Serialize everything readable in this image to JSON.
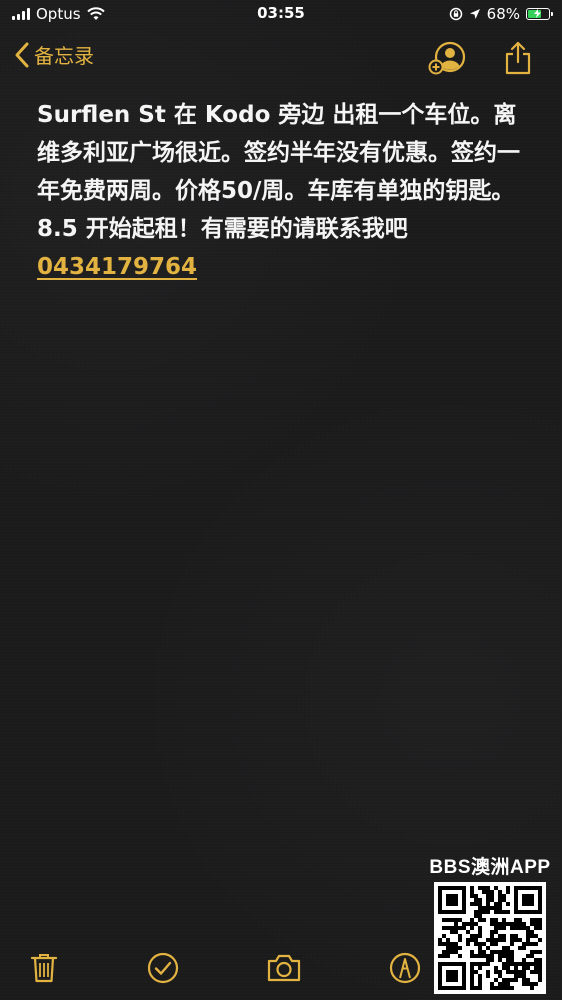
{
  "status_bar": {
    "carrier": "Optus",
    "time": "03:55",
    "battery_percent": "68%",
    "battery_level": 0.68,
    "icons": [
      "signal-icon",
      "wifi-icon",
      "screen-lock-icon",
      "location-icon",
      "battery-charging-icon"
    ]
  },
  "nav": {
    "back_label": "备忘录",
    "icons": [
      "chevron-left-icon",
      "add-person-icon",
      "share-icon"
    ]
  },
  "note": {
    "body": "Surflen St 在 Kodo 旁边 出租一个车位。离维多利亚广场很近。签约半年没有优惠。签约一年免费两周。价格50/周。车库有单独的钥匙。8.5 开始起租！有需要的请联系我吧",
    "phone": "0434179764"
  },
  "toolbar": {
    "icons": [
      "trash-icon",
      "checklist-icon",
      "camera-icon",
      "markup-pen-icon"
    ]
  },
  "watermark": {
    "text": "BBS澳洲APP",
    "icon": "qr-code-icon"
  },
  "colors": {
    "accent": "#e3b341",
    "background": "#1b1b1c",
    "text": "#f5f5f5"
  }
}
